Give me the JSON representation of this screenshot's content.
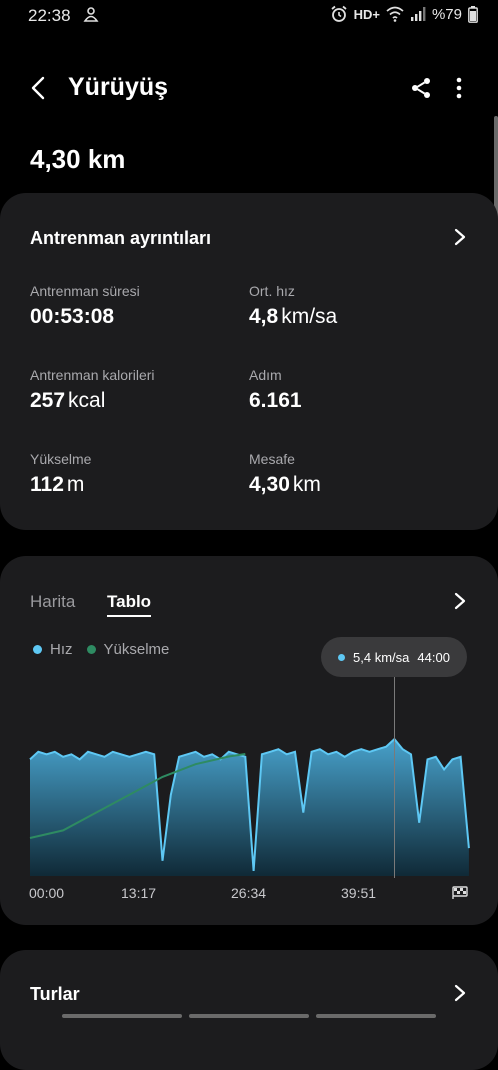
{
  "status_bar": {
    "time": "22:38",
    "network": "HD+",
    "battery": "%79"
  },
  "app_bar": {
    "title": "Yürüyüş"
  },
  "summary": {
    "distance": "4,30 km"
  },
  "details": {
    "title": "Antrenman ayrıntıları",
    "stats": [
      {
        "label": "Antrenman süresi",
        "value": "00:53:08",
        "unit": ""
      },
      {
        "label": "Ort. hız",
        "value": "4,8",
        "unit": "km/sa"
      },
      {
        "label": "Antrenman kalorileri",
        "value": "257",
        "unit": "kcal"
      },
      {
        "label": "Adım",
        "value": "6.161",
        "unit": ""
      },
      {
        "label": "Yükselme",
        "value": "112",
        "unit": "m"
      },
      {
        "label": "Mesafe",
        "value": "4,30",
        "unit": "km"
      }
    ]
  },
  "chart_card": {
    "tabs": [
      "Harita",
      "Tablo"
    ],
    "active_tab": "Tablo",
    "legend": [
      {
        "name": "Hız",
        "color": "#5ec8f4"
      },
      {
        "name": "Yükselme",
        "color": "#2e8b62"
      }
    ],
    "tooltip": {
      "value": "5,4 km/sa",
      "time": "44:00"
    },
    "x_labels": [
      "00:00",
      "13:17",
      "26:34",
      "39:51"
    ],
    "end_icon": "finish-flag-icon"
  },
  "chart_data": {
    "type": "area",
    "x_range_minutes": [
      0,
      53.13
    ],
    "x_ticks": [
      "00:00",
      "13:17",
      "26:34",
      "39:51"
    ],
    "series": [
      {
        "name": "Hız",
        "color": "#5ec8f4",
        "x": [
          0,
          1,
          2,
          3,
          4,
          5,
          6,
          7,
          8,
          9,
          10,
          11,
          12,
          13,
          14,
          15,
          16,
          17,
          18,
          19,
          20,
          21,
          22,
          23,
          24,
          25,
          26,
          27,
          28,
          29,
          30,
          31,
          32,
          33,
          34,
          35,
          36,
          37,
          38,
          39,
          40,
          41,
          42,
          43,
          44,
          45,
          46,
          47,
          48,
          49,
          50,
          51,
          52,
          53
        ],
        "values": [
          4.6,
          4.9,
          4.8,
          4.9,
          4.7,
          4.8,
          4.6,
          4.9,
          4.8,
          4.7,
          4.9,
          4.8,
          4.7,
          4.8,
          4.9,
          4.8,
          0.6,
          3.2,
          4.7,
          4.8,
          4.9,
          4.7,
          4.8,
          4.6,
          4.9,
          4.8,
          4.7,
          0.2,
          4.8,
          4.9,
          5.0,
          4.8,
          4.9,
          2.5,
          4.9,
          5.0,
          4.8,
          4.9,
          4.7,
          4.9,
          5.0,
          4.9,
          5.0,
          5.1,
          5.4,
          5.0,
          4.8,
          2.1,
          4.6,
          4.7,
          4.2,
          4.6,
          4.7,
          1.1
        ]
      },
      {
        "name": "Yükselme",
        "color": "#2e8b62",
        "x": [
          0,
          4,
          8,
          12,
          16,
          20,
          24,
          26
        ],
        "values": [
          0,
          6,
          20,
          34,
          48,
          58,
          64,
          66
        ]
      }
    ],
    "annotation": {
      "x": 44,
      "label": "5,4 km/sa",
      "time": "44:00"
    }
  },
  "laps": {
    "title": "Turlar"
  }
}
